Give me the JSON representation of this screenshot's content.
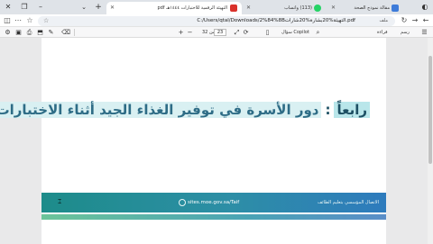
{
  "tabs": [
    {
      "title": "التهيئة الرقمية للاختبارات ١٤٤٤هـ pdf",
      "active": true
    },
    {
      "title": "(113) واتساب",
      "active": false
    },
    {
      "title": "مقالة نموذج الصحة",
      "active": false
    }
  ],
  "address": {
    "url": "C:/Users/qtal/Downloads/2%84%8Bالتهيئة%20بشارة%20شارات.pdf",
    "scheme_label": "ملف"
  },
  "pdf_toolbar": {
    "contents_label": "رسم",
    "read_aloud_label": "قراءة",
    "page_current": "23",
    "page_total": "من 32",
    "search_label": "سؤال Copilot"
  },
  "document": {
    "heading_label": "رابعاً",
    "heading_colon": ":",
    "heading_text": "دور الأسرة في توفير الغذاء الجيد أثناء الاختبارات",
    "footer_url": "sites.moe.gov.sa/Taif",
    "footer_entity": "الاتصال المؤسسي بتعليم الطائف"
  },
  "colors": {
    "heading_highlight": "#b9e6ea",
    "heading_text": "#1d4f63",
    "footer_start": "#1d8c8a",
    "footer_end": "#2e7bbd"
  }
}
